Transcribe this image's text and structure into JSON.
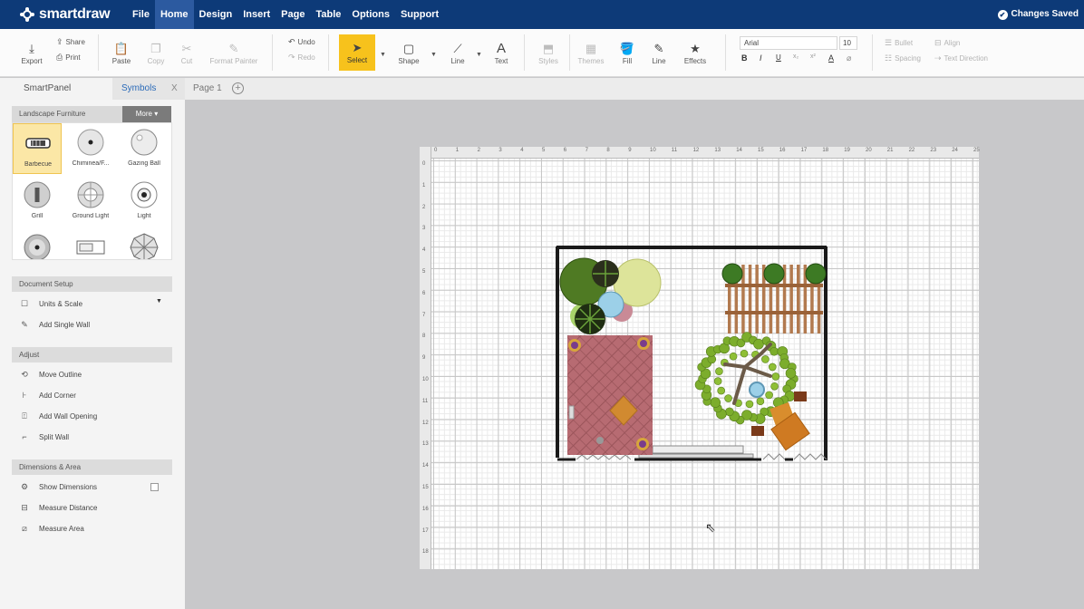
{
  "app": {
    "logo_text": "smartdraw",
    "save_status": "Changes Saved"
  },
  "menu": [
    "File",
    "Home",
    "Design",
    "Insert",
    "Page",
    "Table",
    "Options",
    "Support"
  ],
  "menu_active": "Home",
  "ribbon": {
    "export": "Export",
    "share": "Share",
    "print": "Print",
    "paste": "Paste",
    "copy": "Copy",
    "cut": "Cut",
    "format_painter": "Format Painter",
    "undo": "Undo",
    "redo": "Redo",
    "select": "Select",
    "shape": "Shape",
    "line": "Line",
    "text": "Text",
    "styles": "Styles",
    "themes": "Themes",
    "fill": "Fill",
    "line2": "Line",
    "effects": "Effects",
    "font_name": "Arial",
    "font_size": "10",
    "bold": "B",
    "italic": "I",
    "underline": "U",
    "subscript": "x₂",
    "superscript": "x²",
    "font_color": "A",
    "clear_format": "⌀",
    "bullet": "Bullet",
    "align": "Align",
    "spacing": "Spacing",
    "text_direction": "Text Direction"
  },
  "tabs": {
    "smartpanel": "SmartPanel",
    "symbols": "Symbols",
    "close": "X",
    "page": "Page 1",
    "add_page": "+"
  },
  "library": {
    "name": "Landscape Furniture",
    "more": "More ▾",
    "symbols": [
      "Barbecue",
      "Chiminea/F...",
      "Gazing Ball",
      "Grill",
      "Ground Light",
      "Light"
    ]
  },
  "sections": {
    "document_setup": {
      "title": "Document Setup",
      "items": [
        "Units & Scale",
        "Add Single Wall"
      ]
    },
    "adjust": {
      "title": "Adjust",
      "items": [
        "Move Outline",
        "Add Corner",
        "Add Wall Opening",
        "Split Wall"
      ]
    },
    "dimensions": {
      "title": "Dimensions & Area",
      "items": [
        "Show Dimensions",
        "Measure Distance",
        "Measure Area"
      ]
    }
  },
  "rulers": {
    "top": [
      "0",
      "1",
      "2",
      "3",
      "4",
      "5",
      "6",
      "7",
      "8",
      "9",
      "10",
      "11",
      "12",
      "13",
      "14",
      "15",
      "16",
      "17",
      "18",
      "19",
      "20",
      "21",
      "22",
      "23",
      "24",
      "25"
    ],
    "left": [
      "0",
      "1",
      "2",
      "3",
      "4",
      "5",
      "6",
      "7",
      "8",
      "9",
      "10",
      "11",
      "12",
      "13",
      "14",
      "15",
      "16",
      "17",
      "18"
    ]
  },
  "colors": {
    "menubar": "#0d3a78",
    "select_highlight": "#f7c21c",
    "symbols_tab_text": "#2a6ab8",
    "wall": "#1a1a1a",
    "patio": "#b76b72",
    "pergola": "#b27a4f",
    "shrub": "#7cad2c"
  }
}
